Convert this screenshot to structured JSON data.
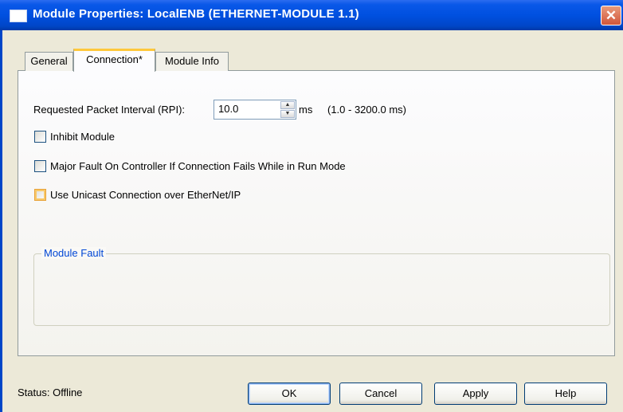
{
  "window": {
    "title": "Module Properties: LocalENB (ETHERNET-MODULE 1.1)",
    "close_glyph": "✕"
  },
  "tabs": [
    {
      "label": "General"
    },
    {
      "label": "Connection*",
      "active": true
    },
    {
      "label": "Module Info"
    }
  ],
  "connection": {
    "rpi_label": "Requested Packet Interval (RPI):",
    "rpi_value": "10.0",
    "rpi_unit": "ms",
    "rpi_range": "(1.0 - 3200.0 ms)",
    "inhibit_label": "Inhibit Module",
    "inhibit_checked": false,
    "major_fault_label": "Major Fault On Controller If Connection Fails While in Run Mode",
    "major_fault_checked": false,
    "unicast_label": "Use Unicast Connection over EtherNet/IP",
    "unicast_checked": false,
    "module_fault_title": "Module Fault"
  },
  "footer": {
    "status": "Status:  Offline",
    "ok": "OK",
    "cancel": "Cancel",
    "apply": "Apply",
    "help": "Help"
  },
  "icons": {
    "window_icon": "window-icon",
    "spin_up": "▲",
    "spin_down": "▼"
  },
  "colors": {
    "titlebar": "#0050e0",
    "tab_highlight": "#ffc83c",
    "group_title": "#0046d5"
  }
}
